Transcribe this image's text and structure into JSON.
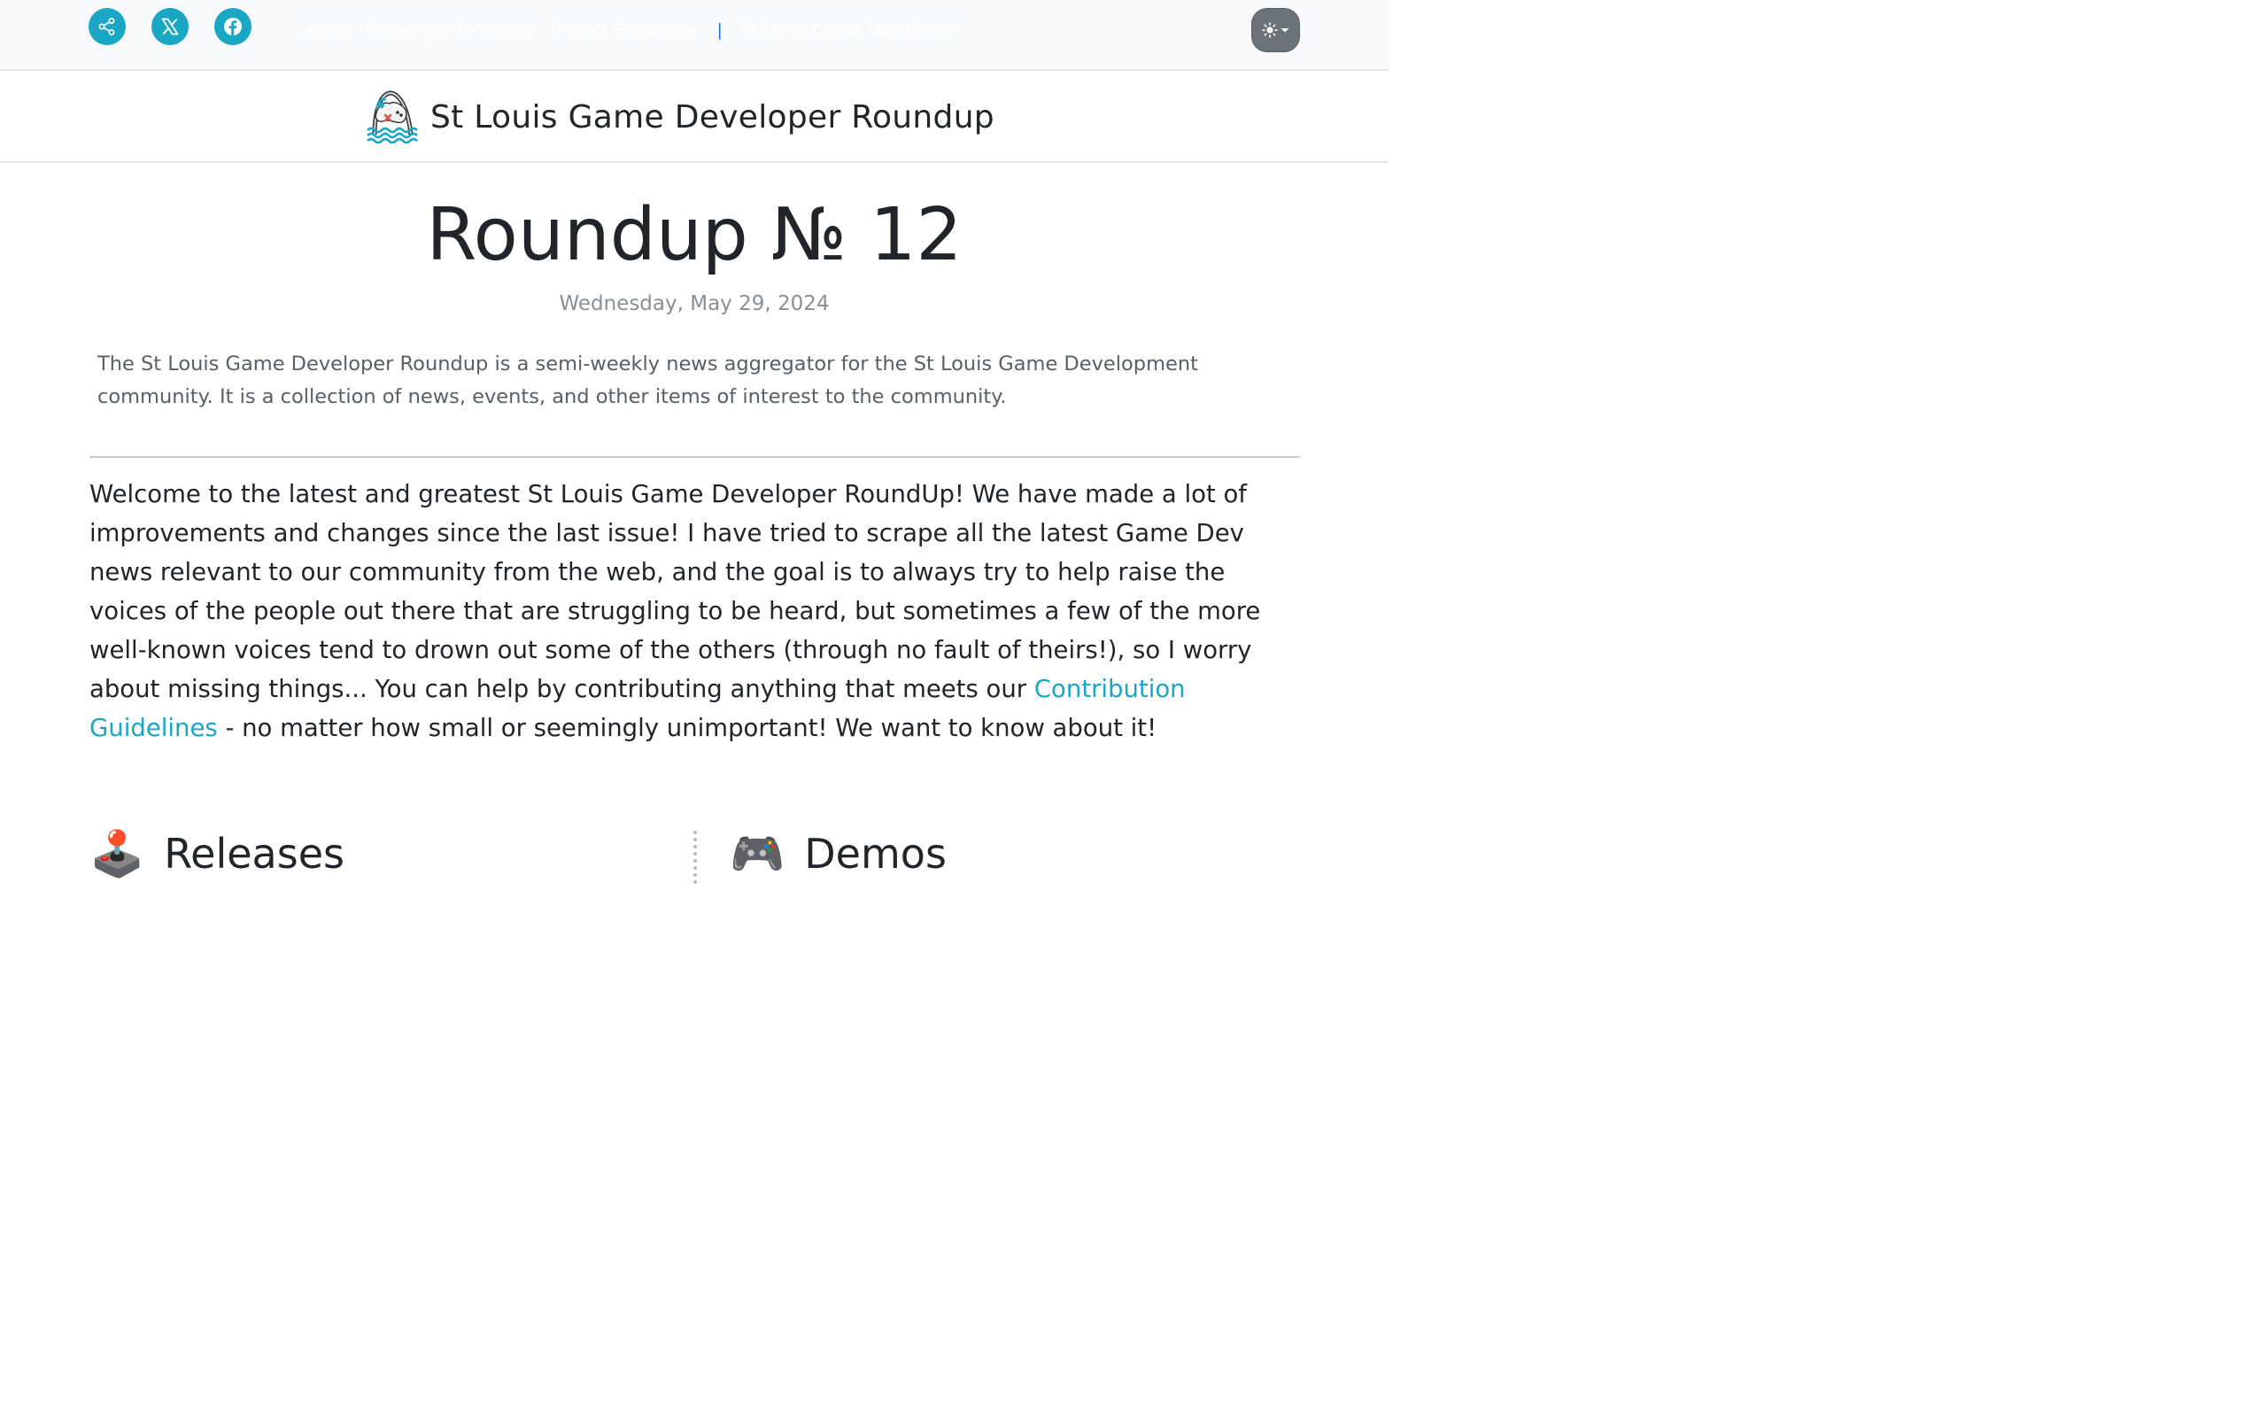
{
  "topbar": {
    "social": [
      {
        "icon": "share-icon"
      },
      {
        "icon": "x-twitter-icon"
      },
      {
        "icon": "facebook-icon"
      }
    ],
    "nav": {
      "home": "Home",
      "directory": "Developer Directory",
      "showcase": "Project Showcase",
      "separator": "|",
      "coop": "St Louis Game Dev Co-op"
    },
    "theme_toggle": {
      "icon": "sun-icon"
    }
  },
  "brand": {
    "title": "St Louis Game Developer Roundup",
    "logo": "arch-gamepad-logo"
  },
  "article": {
    "title": "Roundup № 12",
    "date": "Wednesday, May 29, 2024",
    "lead": "The St Louis Game Developer Roundup is a semi-weekly news aggregator for the St Louis Game Development community. It is a collection of news, events, and other items of interest to the community.",
    "intro_before_link": "Welcome to the latest and greatest St Louis Game Developer RoundUp! We have made a lot of improvements and changes since the last issue! I have tried to scrape all the latest Game Dev news relevant to our community from the web, and the goal is to always try to help raise the voices of the people out there that are struggling to be heard, but sometimes a few of the more well-known voices tend to drown out some of the others (through no fault of theirs!), so I worry about missing things... You can help by contributing anything that meets our ",
    "intro_link": "Contribution Guidelines",
    "intro_after_link": " - no matter how small or seemingly unimportant! We want to know about it!"
  },
  "sections": [
    {
      "emoji": "🕹️",
      "title": "Releases"
    },
    {
      "emoji": "🎮",
      "title": "Demos"
    }
  ],
  "colors": {
    "accent": "#1aa7c4",
    "topbar_bg": "#f8f9fa",
    "theme_button": "#6c7378",
    "separator": "#1a73d9"
  }
}
